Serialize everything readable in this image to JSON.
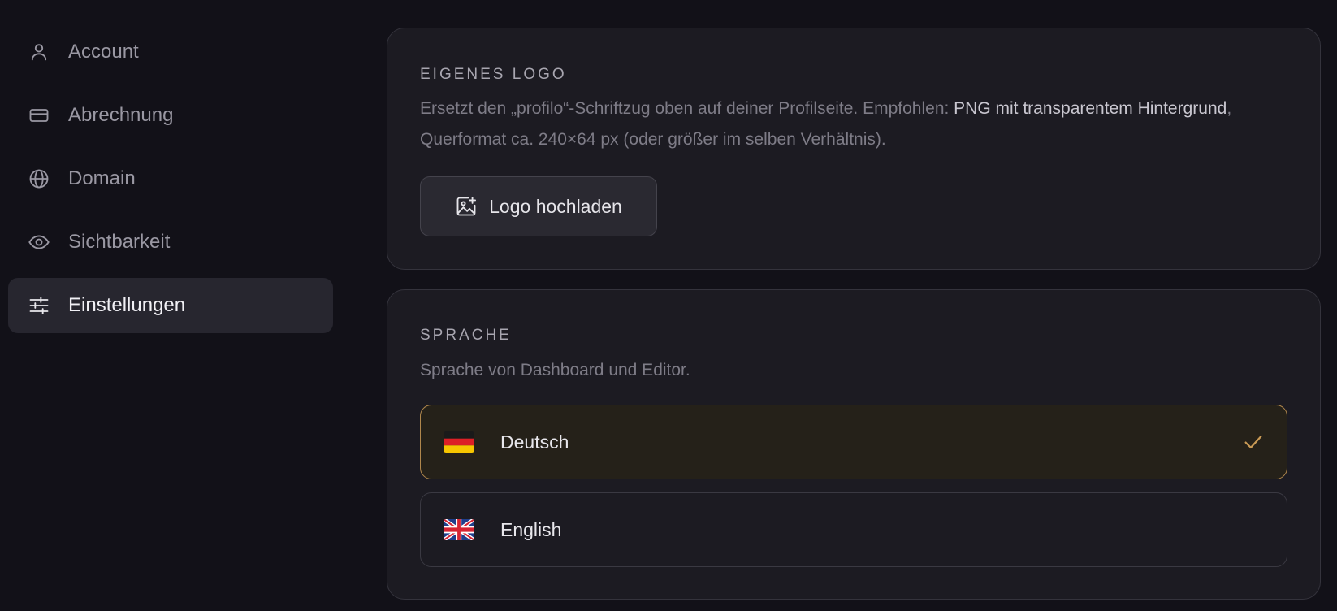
{
  "sidebar": {
    "items": [
      {
        "label": "Account",
        "icon": "user-icon",
        "active": false
      },
      {
        "label": "Abrechnung",
        "icon": "credit-card-icon",
        "active": false
      },
      {
        "label": "Domain",
        "icon": "globe-icon",
        "active": false
      },
      {
        "label": "Sichtbarkeit",
        "icon": "eye-icon",
        "active": false
      },
      {
        "label": "Einstellungen",
        "icon": "sliders-icon",
        "active": true
      }
    ]
  },
  "logo_section": {
    "title": "EIGENES LOGO",
    "desc_part1": "Ersetzt den „profilo“-Schriftzug oben auf deiner Profilseite. Empfohlen: ",
    "desc_highlight": "PNG mit transparentem Hintergrund",
    "desc_part2": ", Querformat ca. 240×64 px (oder größer im selben Verhältnis).",
    "upload_label": "Logo hochladen",
    "upload_icon": "image-plus-icon"
  },
  "language_section": {
    "title": "SPRACHE",
    "desc": "Sprache von Dashboard und Editor.",
    "options": [
      {
        "label": "Deutsch",
        "flag": "germany-flag-icon",
        "selected": true
      },
      {
        "label": "English",
        "flag": "uk-flag-icon",
        "selected": false
      }
    ]
  },
  "colors": {
    "background": "#121118",
    "card": "#1c1b22",
    "accent": "#b0874c",
    "active_nav": "#27262f"
  }
}
